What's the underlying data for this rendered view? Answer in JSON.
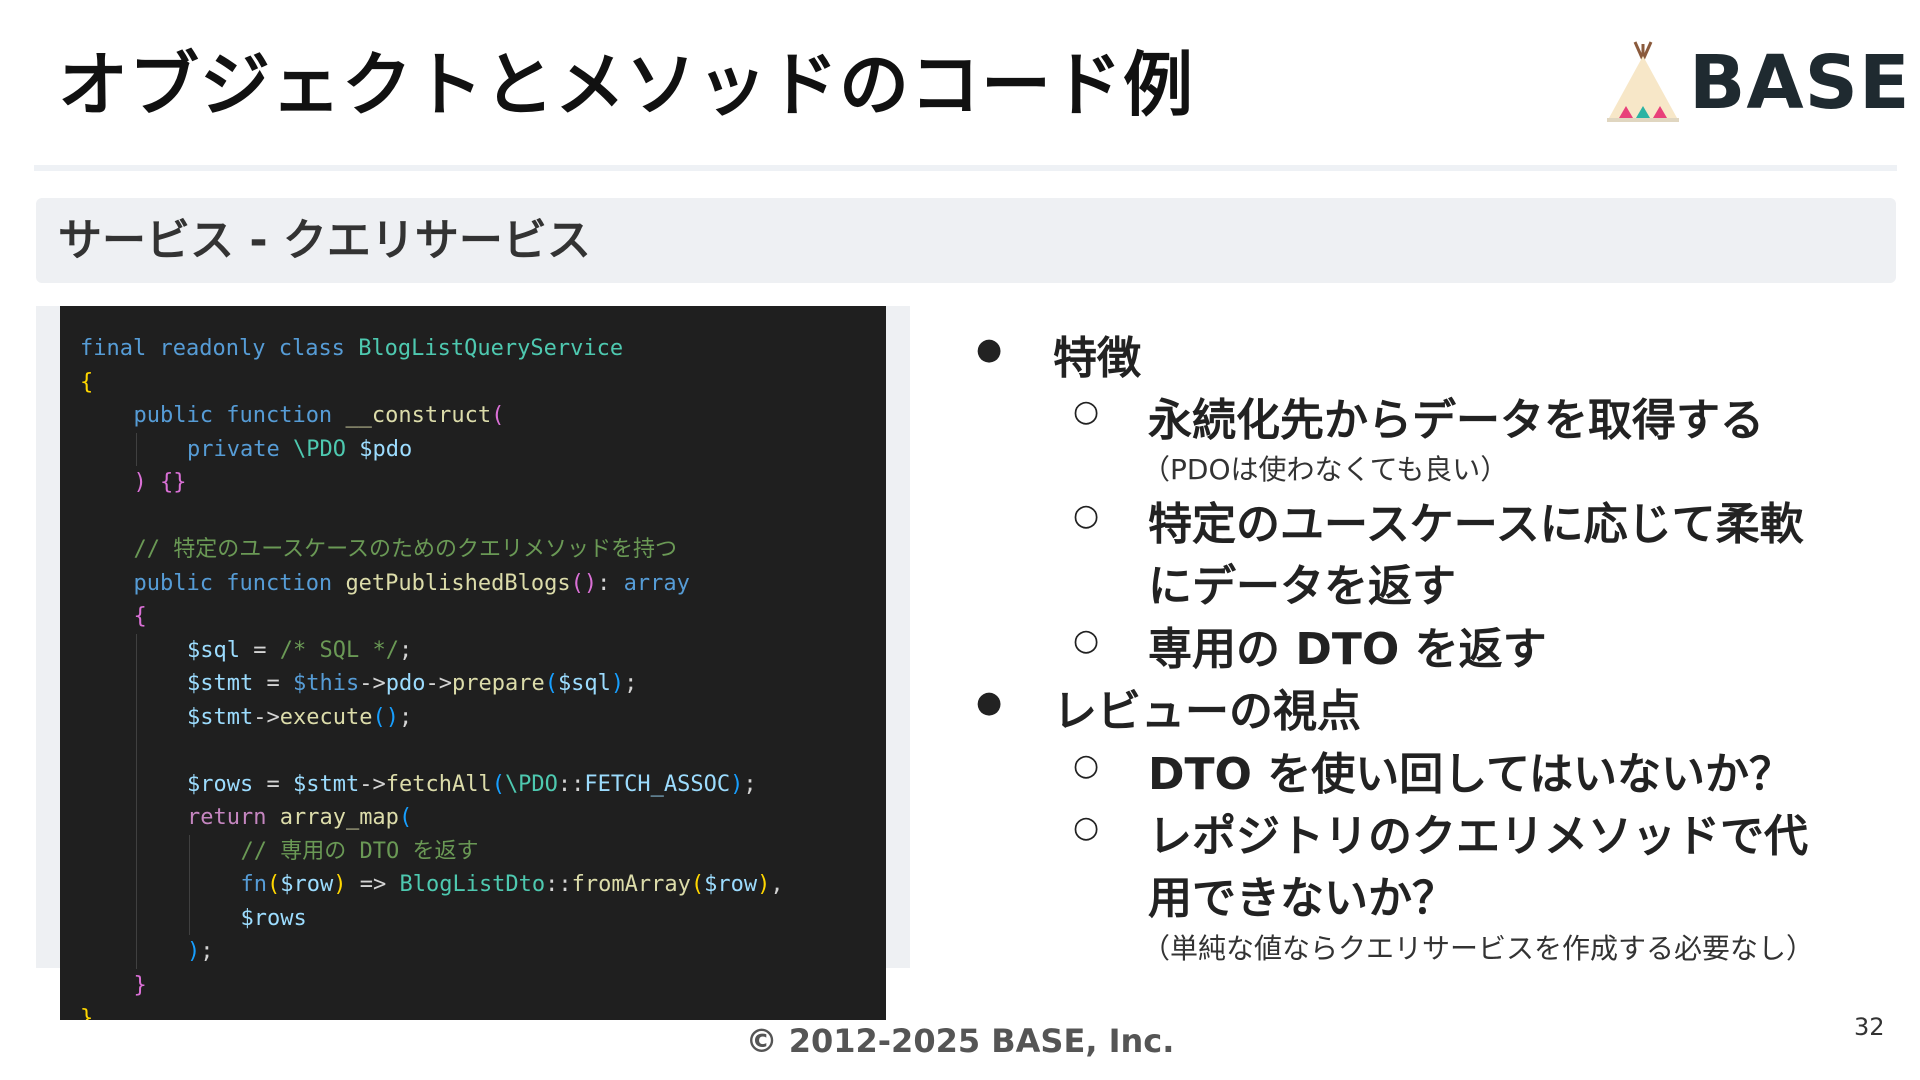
{
  "slide": {
    "title": "オブジェクトとメソッドのコード例",
    "section": "サービス - クエリサービス",
    "logo_text": "BASE",
    "footer": "© 2012-2025 BASE, Inc.",
    "page_number": "32"
  },
  "code": {
    "lines": [
      {
        "indent": 0,
        "tokens": [
          [
            "kw",
            "final "
          ],
          [
            "kw",
            "readonly "
          ],
          [
            "kw",
            "class "
          ],
          [
            "cls",
            "BlogListQueryService"
          ]
        ]
      },
      {
        "indent": 0,
        "tokens": [
          [
            "br1",
            "{"
          ]
        ]
      },
      {
        "indent": 1,
        "tokens": [
          [
            "kw",
            "public "
          ],
          [
            "kw",
            "function "
          ],
          [
            "fn",
            "__construct"
          ],
          [
            "br2",
            "("
          ]
        ]
      },
      {
        "indent": 2,
        "tokens": [
          [
            "kw",
            "private "
          ],
          [
            "cls",
            "\\PDO "
          ],
          [
            "var",
            "$pdo"
          ]
        ]
      },
      {
        "indent": 1,
        "tokens": [
          [
            "br2",
            ") "
          ],
          [
            "br2",
            "{}"
          ]
        ]
      },
      {
        "indent": 0,
        "tokens": []
      },
      {
        "indent": 1,
        "tokens": [
          [
            "cmt",
            "// 特定のユースケースのためのクエリメソッドを持つ"
          ]
        ]
      },
      {
        "indent": 1,
        "tokens": [
          [
            "kw",
            "public "
          ],
          [
            "kw",
            "function "
          ],
          [
            "fn",
            "getPublishedBlogs"
          ],
          [
            "br2",
            "()"
          ],
          [
            "pun",
            ": "
          ],
          [
            "kw",
            "array"
          ]
        ]
      },
      {
        "indent": 1,
        "tokens": [
          [
            "br2",
            "{"
          ]
        ]
      },
      {
        "indent": 2,
        "tokens": [
          [
            "var",
            "$sql"
          ],
          [
            "pun",
            " = "
          ],
          [
            "cmt",
            "/* SQL */"
          ],
          [
            "pun",
            ";"
          ]
        ]
      },
      {
        "indent": 2,
        "tokens": [
          [
            "var",
            "$stmt"
          ],
          [
            "pun",
            " = "
          ],
          [
            "kw",
            "$this"
          ],
          [
            "pun",
            "->"
          ],
          [
            "var",
            "pdo"
          ],
          [
            "pun",
            "->"
          ],
          [
            "fn",
            "prepare"
          ],
          [
            "br3",
            "("
          ],
          [
            "var",
            "$sql"
          ],
          [
            "br3",
            ")"
          ],
          [
            "pun",
            ";"
          ]
        ]
      },
      {
        "indent": 2,
        "tokens": [
          [
            "var",
            "$stmt"
          ],
          [
            "pun",
            "->"
          ],
          [
            "fn",
            "execute"
          ],
          [
            "br3",
            "()"
          ],
          [
            "pun",
            ";"
          ]
        ]
      },
      {
        "indent": 0,
        "tokens": []
      },
      {
        "indent": 2,
        "tokens": [
          [
            "var",
            "$rows"
          ],
          [
            "pun",
            " = "
          ],
          [
            "var",
            "$stmt"
          ],
          [
            "pun",
            "->"
          ],
          [
            "fn",
            "fetchAll"
          ],
          [
            "br3",
            "("
          ],
          [
            "cls",
            "\\PDO"
          ],
          [
            "pun",
            "::"
          ],
          [
            "var",
            "FETCH_ASSOC"
          ],
          [
            "br3",
            ")"
          ],
          [
            "pun",
            ";"
          ]
        ]
      },
      {
        "indent": 2,
        "tokens": [
          [
            "ctl",
            "return "
          ],
          [
            "fn",
            "array_map"
          ],
          [
            "br3",
            "("
          ]
        ]
      },
      {
        "indent": 3,
        "tokens": [
          [
            "cmt",
            "// 専用の DTO を返す"
          ]
        ]
      },
      {
        "indent": 3,
        "tokens": [
          [
            "kw",
            "fn"
          ],
          [
            "br1",
            "("
          ],
          [
            "var",
            "$row"
          ],
          [
            "br1",
            ")"
          ],
          [
            "pun",
            " => "
          ],
          [
            "cls",
            "BlogListDto"
          ],
          [
            "pun",
            "::"
          ],
          [
            "fn",
            "fromArray"
          ],
          [
            "br1",
            "("
          ],
          [
            "var",
            "$row"
          ],
          [
            "br1",
            ")"
          ],
          [
            "pun",
            ","
          ]
        ]
      },
      {
        "indent": 3,
        "tokens": [
          [
            "var",
            "$rows"
          ]
        ]
      },
      {
        "indent": 2,
        "tokens": [
          [
            "br3",
            ")"
          ],
          [
            "pun",
            ";"
          ]
        ]
      },
      {
        "indent": 1,
        "tokens": [
          [
            "br2",
            "}"
          ]
        ]
      },
      {
        "indent": 0,
        "tokens": [
          [
            "br1",
            "}"
          ]
        ]
      }
    ]
  },
  "bullets": [
    {
      "level": 1,
      "text": "特徴"
    },
    {
      "level": 2,
      "text": "永続化先からデータを取得する",
      "note": "（PDOは使わなくても良い）"
    },
    {
      "level": 2,
      "text": "特定のユースケースに応じて柔軟",
      "text2": "にデータを返す"
    },
    {
      "level": 2,
      "text": "専用の DTO を返す"
    },
    {
      "level": 1,
      "text": "レビューの視点"
    },
    {
      "level": 2,
      "text": "DTO を使い回してはいないか？"
    },
    {
      "level": 2,
      "text": "レポジトリのクエリメソッドで代",
      "text2": "用できないか？",
      "note": "（単純な値ならクエリサービスを作成する必要なし）"
    }
  ],
  "icons": {
    "logo": "teepee-logo-icon",
    "bullet_level1": "filled-circle-icon",
    "bullet_level2": "hollow-circle-icon"
  },
  "colors": {
    "logo_text": "#1f2a30",
    "code_background": "#1f1f1f",
    "section_bar": "#eef0f3"
  }
}
